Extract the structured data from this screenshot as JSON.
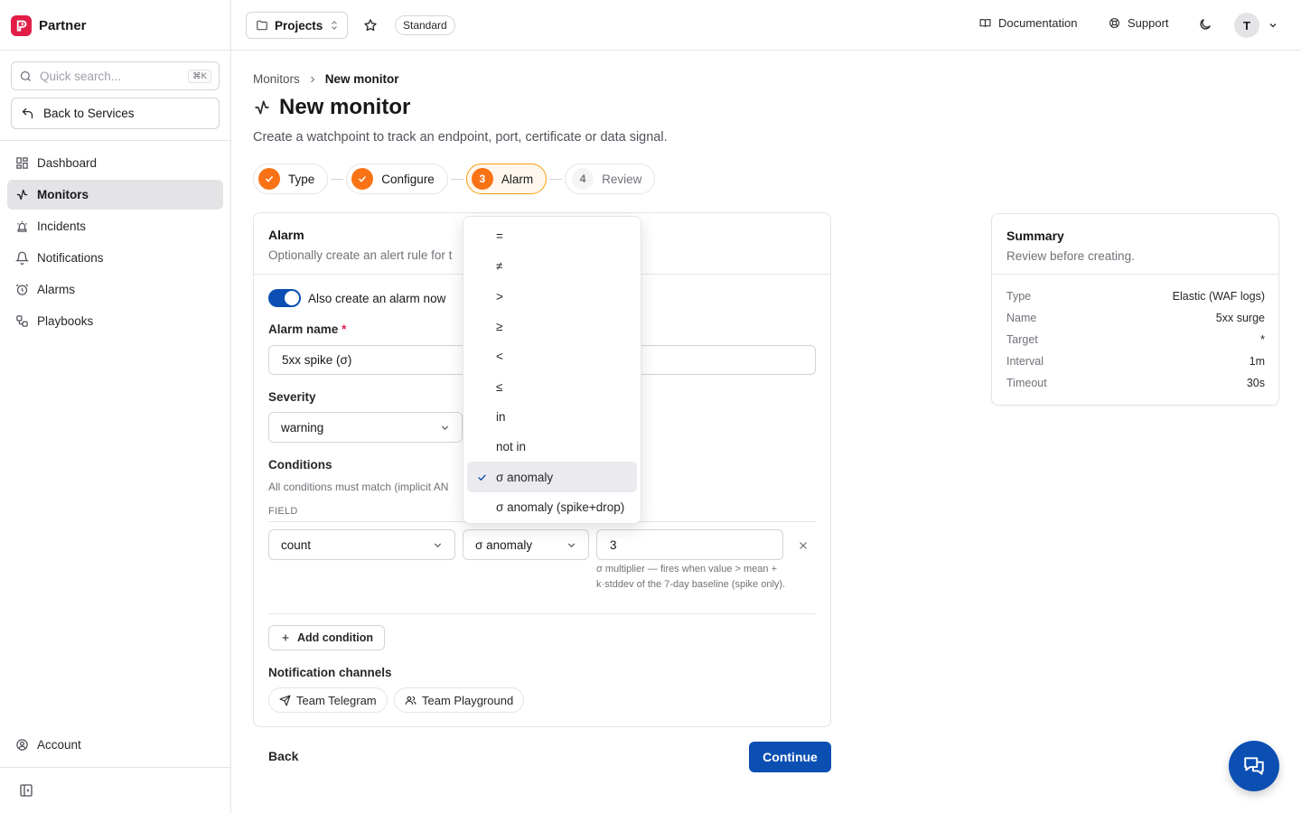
{
  "brand": {
    "name": "Partner",
    "color": "#e11d48"
  },
  "sidebar": {
    "search": {
      "placeholder": "Quick search...",
      "shortcut": "⌘K"
    },
    "back_label": "Back to Services",
    "items": [
      {
        "label": "Dashboard",
        "icon": "dashboard-icon",
        "active": false
      },
      {
        "label": "Monitors",
        "icon": "activity-icon",
        "active": true
      },
      {
        "label": "Incidents",
        "icon": "siren-icon",
        "active": false
      },
      {
        "label": "Notifications",
        "icon": "bell-icon",
        "active": false
      },
      {
        "label": "Alarms",
        "icon": "alarm-clock-icon",
        "active": false
      },
      {
        "label": "Playbooks",
        "icon": "workflow-icon",
        "active": false
      }
    ],
    "account_label": "Account"
  },
  "topbar": {
    "projects_label": "Projects",
    "plan_badge": "Standard",
    "documentation_label": "Documentation",
    "support_label": "Support",
    "avatar_initial": "T"
  },
  "breadcrumb": {
    "parent": "Monitors",
    "current": "New monitor"
  },
  "page": {
    "title": "New monitor",
    "subtitle": "Create a watchpoint to track an endpoint, port, certificate or data signal."
  },
  "steps": [
    {
      "label": "Type",
      "status": "done",
      "number": "1"
    },
    {
      "label": "Configure",
      "status": "done",
      "number": "2"
    },
    {
      "label": "Alarm",
      "status": "current",
      "number": "3"
    },
    {
      "label": "Review",
      "status": "todo",
      "number": "4"
    }
  ],
  "alarm": {
    "title": "Alarm",
    "description": "Optionally create an alert rule for t",
    "toggle_label": "Also create an alarm now",
    "toggle_on": true,
    "name_label": "Alarm name",
    "required_mark": "*",
    "name_value": "5xx spike (σ)",
    "severity_label": "Severity",
    "severity_value": "warning",
    "conditions_label": "Conditions",
    "conditions_hint": "All conditions must match (implicit AN",
    "field_header": "FIELD",
    "condition": {
      "field": "count",
      "operator": "σ anomaly",
      "value": "3",
      "help": "σ multiplier — fires when value > mean + k·stddev of the 7-day baseline (spike only)."
    },
    "add_condition_label": "Add condition",
    "channels_label": "Notification channels",
    "channels": [
      "Team Telegram",
      "Team Playground"
    ]
  },
  "operator_dropdown": {
    "options": [
      "=",
      "≠",
      ">",
      "≥",
      "<",
      "≤",
      "in",
      "not in",
      "σ anomaly",
      "σ anomaly (spike+drop)"
    ],
    "selected": "σ anomaly"
  },
  "footer": {
    "back_label": "Back",
    "continue_label": "Continue"
  },
  "summary": {
    "title": "Summary",
    "subtitle": "Review before creating.",
    "rows": [
      {
        "key": "Type",
        "value": "Elastic (WAF logs)"
      },
      {
        "key": "Name",
        "value": "5xx surge"
      },
      {
        "key": "Target",
        "value": "*"
      },
      {
        "key": "Interval",
        "value": "1m"
      },
      {
        "key": "Timeout",
        "value": "30s"
      }
    ]
  },
  "colors": {
    "accent": "#f97316",
    "primary": "#0b4fb3"
  }
}
